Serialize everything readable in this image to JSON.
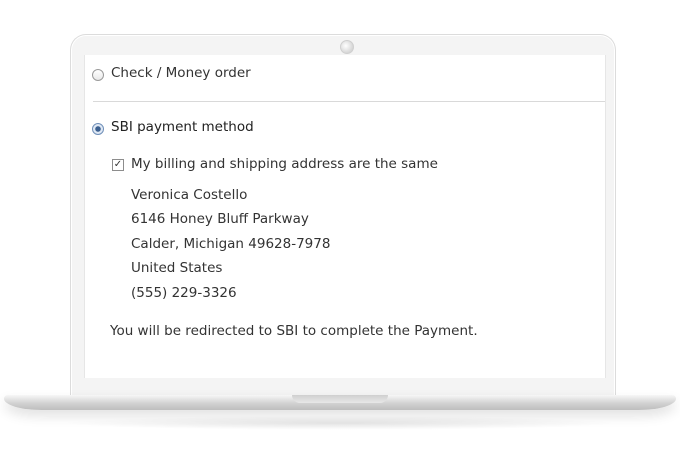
{
  "payment": {
    "option_check": {
      "label": "Check / Money order",
      "selected": false
    },
    "option_sbi": {
      "label": "SBI payment method",
      "selected": true
    },
    "same_address_label": "My billing and shipping address are the same",
    "same_address_checked": true,
    "address": {
      "name": "Veronica Costello",
      "street": "6146 Honey Bluff Parkway",
      "city_line": "Calder, Michigan 49628-7978",
      "country": "United States",
      "phone": "(555) 229-3326"
    },
    "redirect_note": "You will be redirected to SBI to complete the Payment."
  },
  "colors": {
    "radio_selected": "#3b5f8f",
    "text": "#333333",
    "divider": "#d9d9d9"
  }
}
